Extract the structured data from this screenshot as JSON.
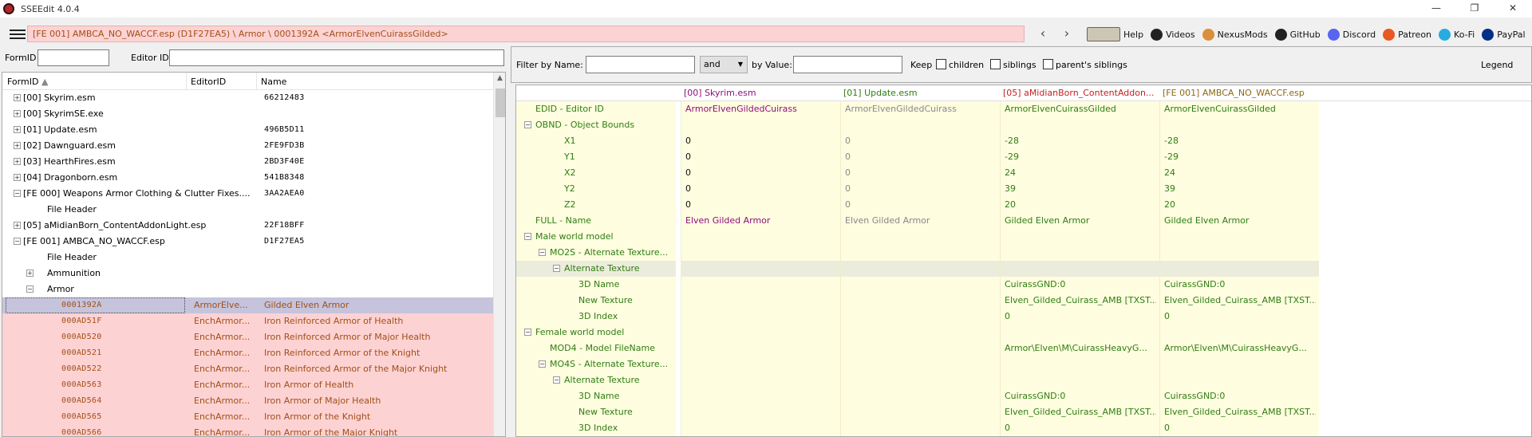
{
  "window": {
    "title": "SSEEdit 4.0.4",
    "minimize": "—",
    "maximize": "❐",
    "close": "✕"
  },
  "toolbar": {
    "path": "[FE 001] AMBCA_NO_WACCF.esp (D1F27EA5) \\ Armor \\ 0001392A <ArmorElvenCuirassGilded>",
    "back": "‹",
    "forward": "›",
    "links": [
      {
        "label": "Help",
        "icon": "book-icon",
        "color": "#ccc6b4"
      },
      {
        "label": "Videos",
        "icon": "videos-icon",
        "color": "#222222"
      },
      {
        "label": "NexusMods",
        "icon": "nexusmods-icon",
        "color": "#d98f3c"
      },
      {
        "label": "GitHub",
        "icon": "github-icon",
        "color": "#222222"
      },
      {
        "label": "Discord",
        "icon": "discord-icon",
        "color": "#5865f2"
      },
      {
        "label": "Patreon",
        "icon": "patreon-icon",
        "color": "#e8581f"
      },
      {
        "label": "Ko-Fi",
        "icon": "kofi-icon",
        "color": "#29abe0"
      },
      {
        "label": "PayPal",
        "icon": "paypal-icon",
        "color": "#003087"
      }
    ]
  },
  "left": {
    "formid_label": "FormID",
    "editorid_label": "Editor ID",
    "columns": {
      "formid": "FormID",
      "editorid": "EditorID",
      "name": "Name"
    },
    "rows": [
      {
        "name": "[00] Skyrim.esm",
        "eid": "",
        "val": "66212483",
        "kind": "file",
        "exp": "+"
      },
      {
        "name": "[00] SkyrimSE.exe",
        "eid": "",
        "val": "",
        "kind": "file",
        "exp": "+"
      },
      {
        "name": "[01] Update.esm",
        "eid": "",
        "val": "496B5D11",
        "kind": "file",
        "exp": "+"
      },
      {
        "name": "[02] Dawnguard.esm",
        "eid": "",
        "val": "2FE9FD3B",
        "kind": "file",
        "exp": "+"
      },
      {
        "name": "[03] HearthFires.esm",
        "eid": "",
        "val": "2BD3F40E",
        "kind": "file",
        "exp": "+"
      },
      {
        "name": "[04] Dragonborn.esm",
        "eid": "",
        "val": "541B8348",
        "kind": "file",
        "exp": "+"
      },
      {
        "name": "[FE 000] Weapons Armor Clothing & Clutter Fixes....",
        "eid": "",
        "val": "3AA2AEA0",
        "kind": "file",
        "exp": "−"
      },
      {
        "name": "File Header",
        "eid": "",
        "val": "",
        "kind": "child",
        "exp": ""
      },
      {
        "name": "[05] aMidianBorn_ContentAddonLight.esp",
        "eid": "",
        "val": "22F18BFF",
        "kind": "file",
        "exp": "+"
      },
      {
        "name": "[FE 001] AMBCA_NO_WACCF.esp",
        "eid": "",
        "val": "D1F27EA5",
        "kind": "file",
        "exp": "−"
      },
      {
        "name": "File Header",
        "eid": "",
        "val": "",
        "kind": "child",
        "exp": ""
      },
      {
        "name": "Ammunition",
        "eid": "",
        "val": "",
        "kind": "child",
        "exp": "+"
      },
      {
        "name": "Armor",
        "eid": "",
        "val": "",
        "kind": "child",
        "exp": "−"
      },
      {
        "name": "0001392A",
        "eid": "ArmorElve...",
        "val": "Gilded Elven Armor",
        "kind": "sel",
        "exp": ""
      },
      {
        "name": "000AD51F",
        "eid": "EnchArmor...",
        "val": "Iron Reinforced Armor of Health",
        "kind": "pink",
        "exp": ""
      },
      {
        "name": "000AD520",
        "eid": "EnchArmor...",
        "val": "Iron Reinforced Armor of Major Health",
        "kind": "pink",
        "exp": ""
      },
      {
        "name": "000AD521",
        "eid": "EnchArmor...",
        "val": "Iron Reinforced Armor of the Knight",
        "kind": "pink",
        "exp": ""
      },
      {
        "name": "000AD522",
        "eid": "EnchArmor...",
        "val": "Iron Reinforced Armor of the Major Knight",
        "kind": "pink",
        "exp": ""
      },
      {
        "name": "000AD563",
        "eid": "EnchArmor...",
        "val": "Iron Armor of Health",
        "kind": "pink",
        "exp": ""
      },
      {
        "name": "000AD564",
        "eid": "EnchArmor...",
        "val": "Iron Armor of Major Health",
        "kind": "pink",
        "exp": ""
      },
      {
        "name": "000AD565",
        "eid": "EnchArmor...",
        "val": "Iron Armor of the Knight",
        "kind": "pink",
        "exp": ""
      },
      {
        "name": "000AD566",
        "eid": "EnchArmor...",
        "val": "Iron Armor of the Major Knight",
        "kind": "pink",
        "exp": ""
      }
    ]
  },
  "right": {
    "filter_name_label": "Filter by Name:",
    "operator": "and",
    "filter_value_label": "by Value:",
    "keep_label": "Keep",
    "children_label": "children",
    "siblings_label": "siblings",
    "parents_label": "parent's siblings",
    "legend": "Legend",
    "columns": [
      "[00] Skyrim.esm",
      "[01] Update.esm",
      "[05] aMidianBorn_ContentAddon...",
      "[FE 001] AMBCA_NO_WACCF.esp"
    ],
    "column_colors": [
      "#8b0f7c",
      "#2e7d12",
      "#c41f1f",
      "#8b6a12"
    ],
    "rows": [
      {
        "label": "EDID - Editor ID",
        "indent": 0,
        "exp": "",
        "vals": [
          "ArmorElvenGildedCuirass",
          "ArmorElvenGildedCuirass",
          "ArmorElvenCuirassGilded",
          "ArmorElvenCuirassGilded"
        ],
        "style": [
          "#8b0f7c",
          "#888888",
          "#2e7d12",
          "#2e7d12"
        ]
      },
      {
        "label": "OBND - Object Bounds",
        "indent": 0,
        "exp": "−",
        "vals": [
          "",
          "",
          "",
          ""
        ],
        "style": [
          "",
          "",
          "",
          ""
        ]
      },
      {
        "label": "X1",
        "indent": 2,
        "exp": "",
        "vals": [
          "0",
          "0",
          "-28",
          "-28"
        ],
        "style": [
          "#111111",
          "#888888",
          "#2e7d12",
          "#2e7d12"
        ]
      },
      {
        "label": "Y1",
        "indent": 2,
        "exp": "",
        "vals": [
          "0",
          "0",
          "-29",
          "-29"
        ],
        "style": [
          "#111111",
          "#888888",
          "#2e7d12",
          "#2e7d12"
        ]
      },
      {
        "label": "X2",
        "indent": 2,
        "exp": "",
        "vals": [
          "0",
          "0",
          "24",
          "24"
        ],
        "style": [
          "#111111",
          "#888888",
          "#2e7d12",
          "#2e7d12"
        ]
      },
      {
        "label": "Y2",
        "indent": 2,
        "exp": "",
        "vals": [
          "0",
          "0",
          "39",
          "39"
        ],
        "style": [
          "#111111",
          "#888888",
          "#2e7d12",
          "#2e7d12"
        ]
      },
      {
        "label": "Z2",
        "indent": 2,
        "exp": "",
        "vals": [
          "0",
          "0",
          "20",
          "20"
        ],
        "style": [
          "#111111",
          "#888888",
          "#2e7d12",
          "#2e7d12"
        ]
      },
      {
        "label": "FULL - Name",
        "indent": 0,
        "exp": "",
        "vals": [
          "Elven Gilded Armor",
          "Elven Gilded Armor",
          "Gilded Elven Armor",
          "Gilded Elven Armor"
        ],
        "style": [
          "#8b0f7c",
          "#888888",
          "#2e7d12",
          "#2e7d12"
        ]
      },
      {
        "label": "Male world model",
        "indent": 0,
        "exp": "−",
        "vals": [
          "",
          "",
          "",
          ""
        ],
        "style": [
          "",
          "",
          "",
          ""
        ]
      },
      {
        "label": "MO2S - Alternate Texture...",
        "indent": 1,
        "exp": "−",
        "vals": [
          "",
          "",
          "",
          ""
        ],
        "style": [
          "",
          "",
          "",
          ""
        ]
      },
      {
        "label": "Alternate Texture",
        "indent": 2,
        "exp": "−",
        "vals": [
          "",
          "",
          "",
          ""
        ],
        "style": [
          "",
          "",
          "",
          ""
        ],
        "hl": true
      },
      {
        "label": "3D Name",
        "indent": 3,
        "exp": "",
        "vals": [
          "",
          "",
          "CuirassGND:0",
          "CuirassGND:0"
        ],
        "style": [
          "",
          "",
          "#2e7d12",
          "#2e7d12"
        ]
      },
      {
        "label": "New Texture",
        "indent": 3,
        "exp": "",
        "vals": [
          "",
          "",
          "Elven_Gilded_Cuirass_AMB [TXST...",
          "Elven_Gilded_Cuirass_AMB [TXST..."
        ],
        "style": [
          "",
          "",
          "#2e7d12",
          "#2e7d12"
        ]
      },
      {
        "label": "3D Index",
        "indent": 3,
        "exp": "",
        "vals": [
          "",
          "",
          "0",
          "0"
        ],
        "style": [
          "",
          "",
          "#2e7d12",
          "#2e7d12"
        ]
      },
      {
        "label": "Female world model",
        "indent": 0,
        "exp": "−",
        "vals": [
          "",
          "",
          "",
          ""
        ],
        "style": [
          "",
          "",
          "",
          ""
        ]
      },
      {
        "label": "MOD4 - Model FileName",
        "indent": 1,
        "exp": "",
        "vals": [
          "",
          "",
          "Armor\\Elven\\M\\CuirassHeavyG...",
          "Armor\\Elven\\M\\CuirassHeavyG..."
        ],
        "style": [
          "",
          "",
          "#2e7d12",
          "#2e7d12"
        ]
      },
      {
        "label": "MO4S - Alternate Texture...",
        "indent": 1,
        "exp": "−",
        "vals": [
          "",
          "",
          "",
          ""
        ],
        "style": [
          "",
          "",
          "",
          ""
        ]
      },
      {
        "label": "Alternate Texture",
        "indent": 2,
        "exp": "−",
        "vals": [
          "",
          "",
          "",
          ""
        ],
        "style": [
          "",
          "",
          "",
          ""
        ]
      },
      {
        "label": "3D Name",
        "indent": 3,
        "exp": "",
        "vals": [
          "",
          "",
          "CuirassGND:0",
          "CuirassGND:0"
        ],
        "style": [
          "",
          "",
          "#2e7d12",
          "#2e7d12"
        ]
      },
      {
        "label": "New Texture",
        "indent": 3,
        "exp": "",
        "vals": [
          "",
          "",
          "Elven_Gilded_Cuirass_AMB [TXST...",
          "Elven_Gilded_Cuirass_AMB [TXST..."
        ],
        "style": [
          "",
          "",
          "#2e7d12",
          "#2e7d12"
        ]
      },
      {
        "label": "3D Index",
        "indent": 3,
        "exp": "",
        "vals": [
          "",
          "",
          "0",
          "0"
        ],
        "style": [
          "",
          "",
          "#2e7d12",
          "#2e7d12"
        ]
      }
    ]
  }
}
